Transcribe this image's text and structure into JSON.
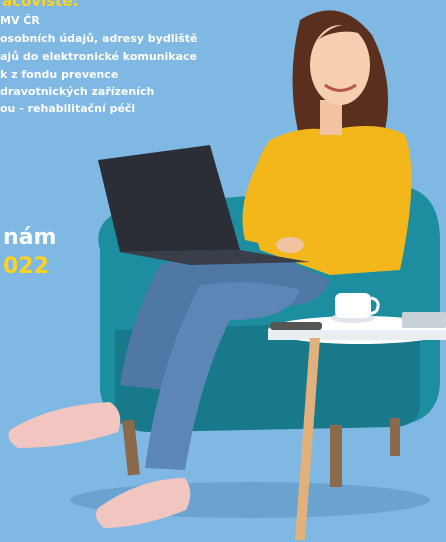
{
  "promo": {
    "heading_partial": "acovisté:",
    "info_lines": [
      "MV ČR",
      "osobních údajů, adresy bydliště",
      "ajů do elektronické komunikace",
      "k z fondu prevence",
      "dravotnických zařízeních",
      "ou - rehabilitační péči"
    ],
    "cta_line": "nám",
    "cta_year": "022"
  },
  "colors": {
    "background": "#7eb8e3",
    "accent_yellow": "#ffd21f",
    "text_white": "#ffffff",
    "chair_teal": "#1d8ea0",
    "sweater_yellow": "#f3b71b"
  },
  "icons": [
    "woman-with-laptop-illustration",
    "armchair-illustration",
    "side-table-illustration",
    "coffee-cup-illustration"
  ]
}
